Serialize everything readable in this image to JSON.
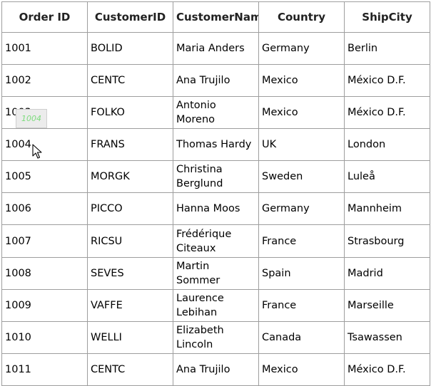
{
  "columns": [
    "Order ID",
    "CustomerID",
    "CustomerName",
    "Country",
    "ShipCity"
  ],
  "rows": [
    [
      "1001",
      "BOLID",
      "Maria Anders",
      "Germany",
      "Berlin"
    ],
    [
      "1002",
      "CENTC",
      "Ana Trujilo",
      "Mexico",
      "México D.F."
    ],
    [
      "1003",
      "FOLKO",
      "Antonio Moreno",
      "Mexico",
      "México D.F."
    ],
    [
      "1004",
      "FRANS",
      "Thomas Hardy",
      "UK",
      "London"
    ],
    [
      "1005",
      "MORGK",
      "Christina Berglund",
      "Sweden",
      "Luleå"
    ],
    [
      "1006",
      "PICCO",
      "Hanna Moos",
      "Germany",
      "Mannheim"
    ],
    [
      "1007",
      "RICSU",
      "Frédérique Citeaux",
      "France",
      "Strasbourg"
    ],
    [
      "1008",
      "SEVES",
      "Martin Sommer",
      "Spain",
      "Madrid"
    ],
    [
      "1009",
      "VAFFE",
      "Laurence Lebihan",
      "France",
      "Marseille"
    ],
    [
      "1010",
      "WELLI",
      "Elizabeth Lincoln",
      "Canada",
      "Tsawassen"
    ],
    [
      "1011",
      "CENTC",
      "Ana Trujilo",
      "Mexico",
      "México D.F."
    ]
  ],
  "drag_clue": {
    "text": "1004"
  },
  "cursor": {
    "icon": "mouse-pointer-icon"
  }
}
